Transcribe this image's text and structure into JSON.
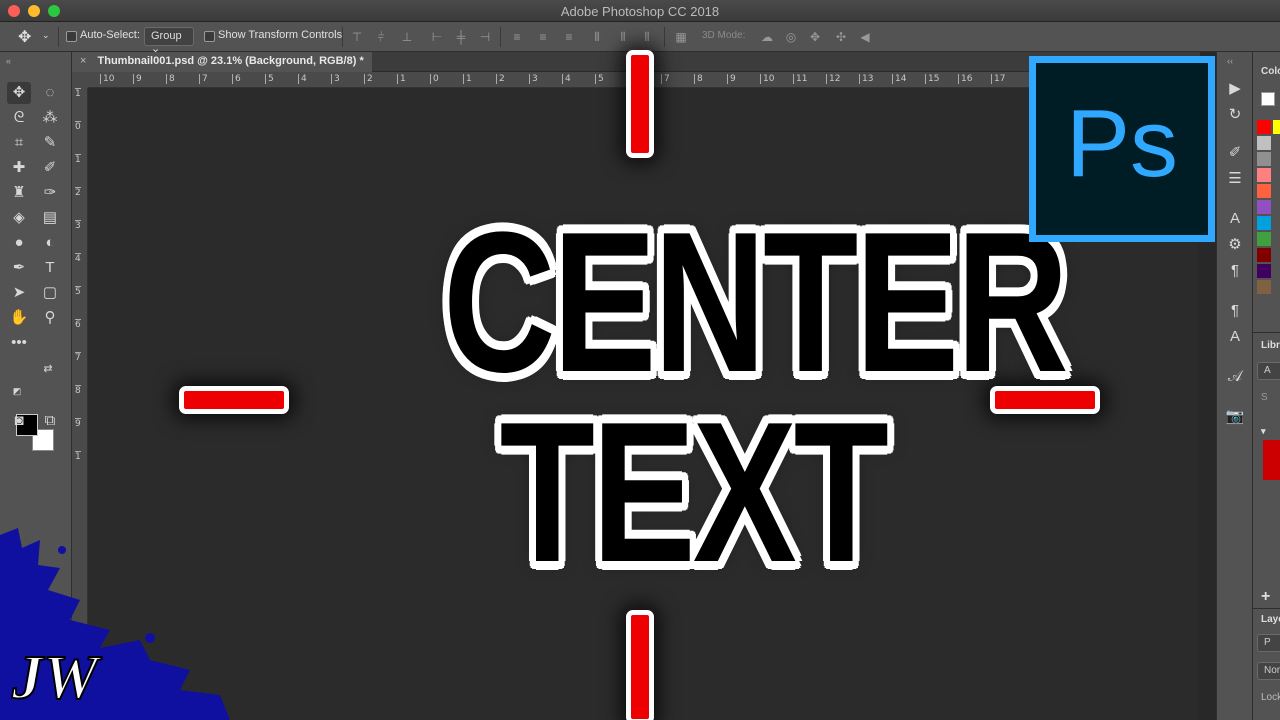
{
  "window": {
    "title": "Adobe Photoshop CC 2018"
  },
  "options_bar": {
    "auto_select_label": "Auto-Select:",
    "auto_select_value": "Group",
    "show_transform_label": "Show Transform Controls",
    "mode_3d_label": "3D Mode:"
  },
  "document": {
    "tab_close": "×",
    "tab_title": "Thumbnail001.psd @ 23.1% (Background, RGB/8) *"
  },
  "rulers": {
    "horizontal": [
      "10",
      "9",
      "8",
      "7",
      "6",
      "5",
      "4",
      "3",
      "2",
      "1",
      "0",
      "1",
      "2",
      "3",
      "4",
      "5",
      "6",
      "7",
      "8",
      "9",
      "10",
      "11",
      "12",
      "13",
      "14",
      "15",
      "16",
      "17"
    ],
    "vertical": [
      "1",
      "0",
      "1",
      "2",
      "3",
      "4",
      "5",
      "6",
      "7",
      "8",
      "9",
      "1"
    ]
  },
  "canvas": {
    "line1": "CENTER",
    "line2": "TEXT"
  },
  "logo": {
    "text": "Ps",
    "color": "#31a8ff",
    "bg": "#001d26"
  },
  "panels": {
    "color_label": "Colo",
    "libraries_label": "Libr",
    "lib_dropdown": "A",
    "search_hint": "S",
    "layers_label": "Laye",
    "kind_value": "P",
    "normal_value": "Nor",
    "lock_label": "Lock"
  },
  "watermark": {
    "text": "JW"
  },
  "colors": {
    "accent_red": "#ee0000",
    "ps_blue": "#31a8ff",
    "ui_gray": "#535353"
  }
}
